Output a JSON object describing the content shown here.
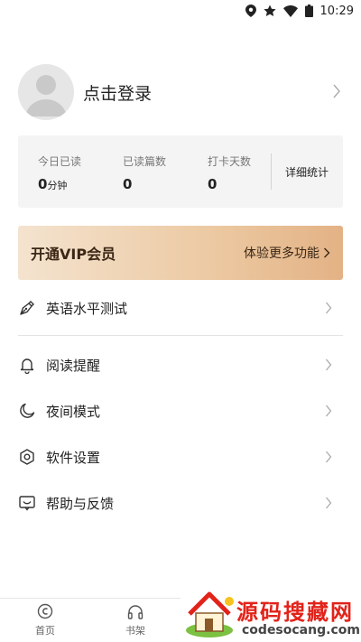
{
  "status_bar": {
    "time": "10:29",
    "icons": [
      "location-icon",
      "star-icon",
      "wifi-icon",
      "battery-icon"
    ]
  },
  "profile": {
    "login_label": "点击登录"
  },
  "stats": {
    "items": [
      {
        "label": "今日已读",
        "value": "0",
        "unit": "分钟"
      },
      {
        "label": "已读篇数",
        "value": "0",
        "unit": ""
      },
      {
        "label": "打卡天数",
        "value": "0",
        "unit": ""
      }
    ],
    "detail_label": "详细统计"
  },
  "vip": {
    "title": "开通VIP会员",
    "action": "体验更多功能"
  },
  "menu": [
    {
      "label": "英语水平测试",
      "icon": "pen-icon"
    },
    {
      "label": "阅读提醒",
      "icon": "bell-icon"
    },
    {
      "label": "夜间模式",
      "icon": "moon-icon"
    },
    {
      "label": "软件设置",
      "icon": "hexagon-settings-icon"
    },
    {
      "label": "帮助与反馈",
      "icon": "feedback-icon"
    }
  ],
  "bottom_nav": {
    "tabs": [
      {
        "label": "首页",
        "icon": "home-icon"
      },
      {
        "label": "书架",
        "icon": "headphones-icon"
      }
    ]
  },
  "watermark": {
    "title": "源码搜藏网",
    "url": "codesocang.com"
  },
  "colors": {
    "vip_gradient_start": "#f4e3cf",
    "vip_gradient_end": "#e3b285",
    "vip_text": "#3a2716",
    "watermark_red": "#e2231a"
  }
}
